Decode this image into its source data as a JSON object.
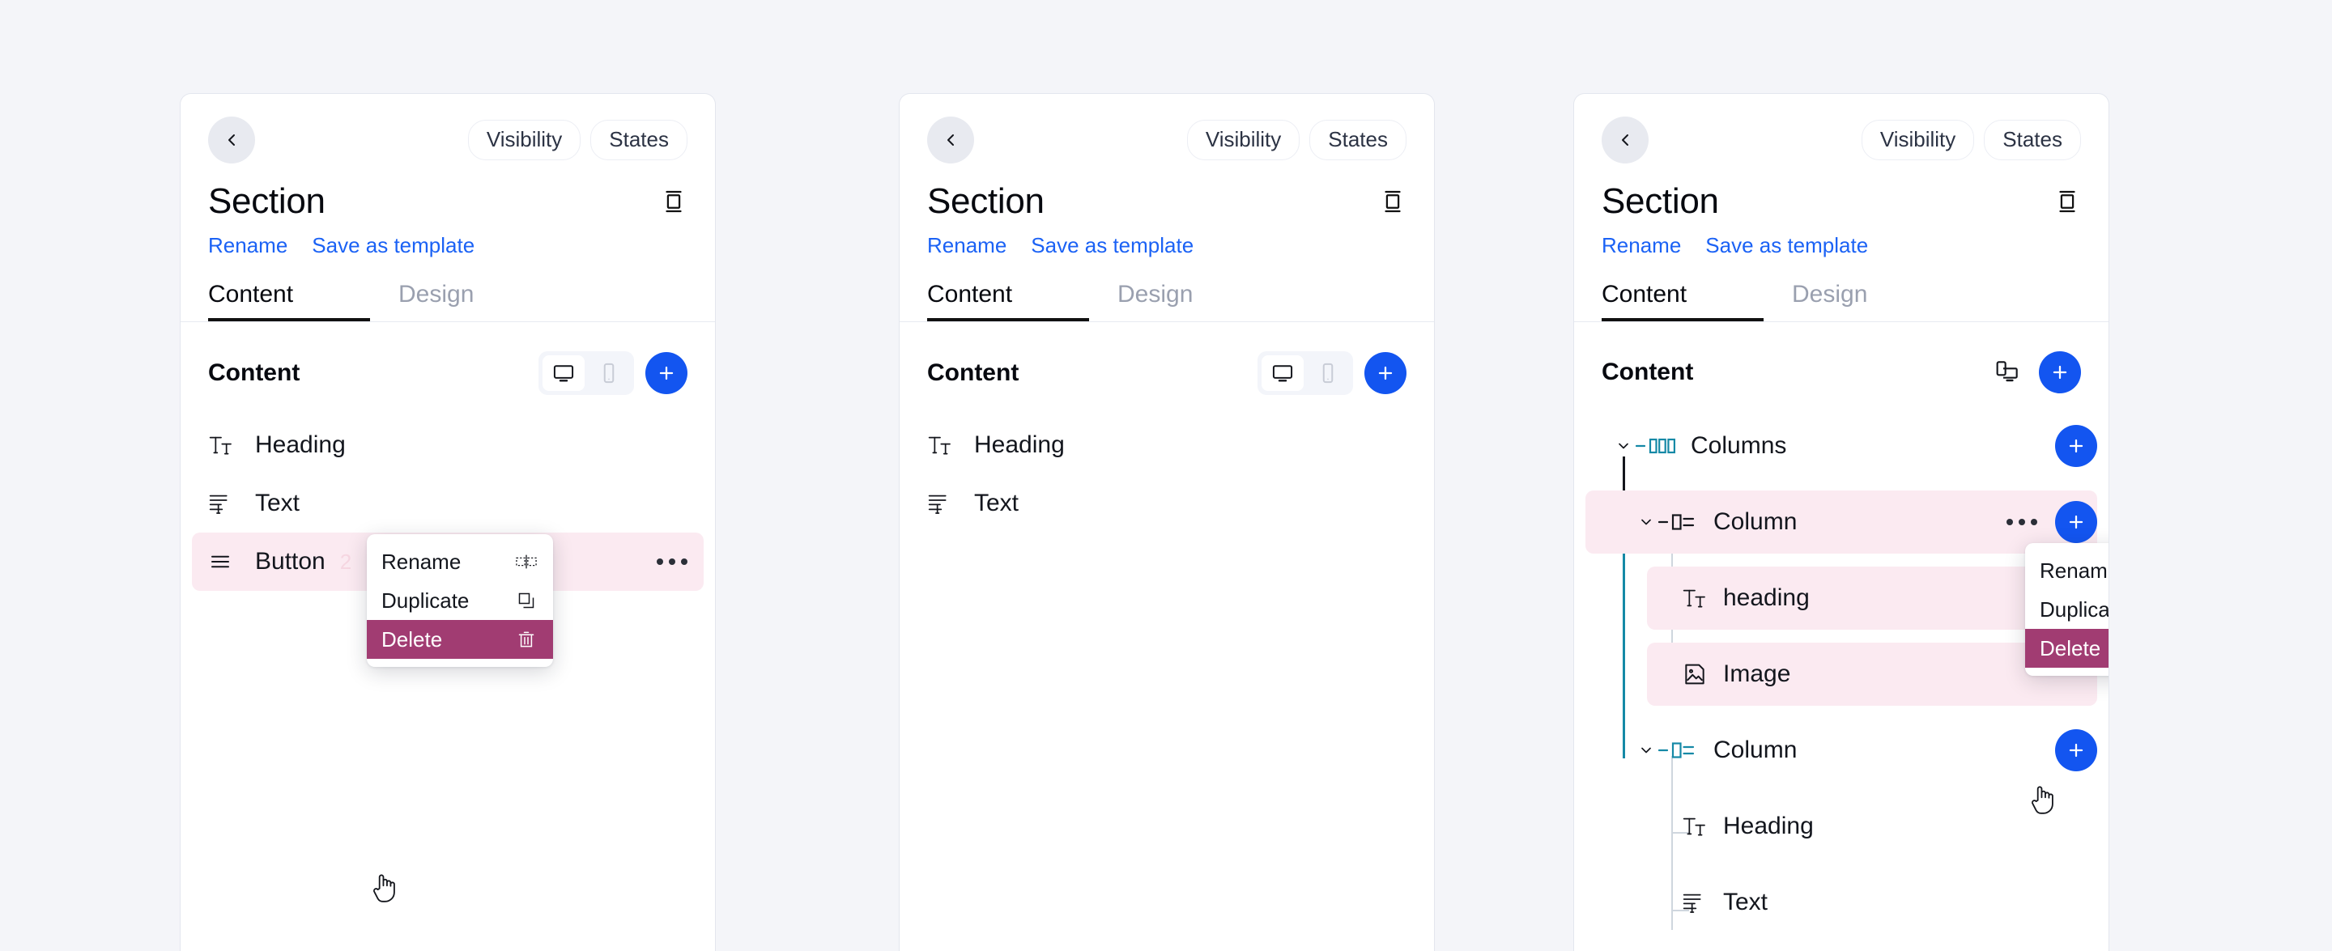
{
  "theme": {
    "page_bg": "#f4f5f9",
    "panel_bg": "#ffffff",
    "accent_blue": "#1355f0",
    "link_blue": "#1b62f5",
    "danger_magenta": "#a13c72",
    "selected_pink": "#fbeaf1",
    "teal": "#1589a6",
    "text_dark": "#13161d",
    "muted": "#9aa0af"
  },
  "panels": [
    {
      "id": "panel-1",
      "header": {
        "back_icon": "chevron-left-icon",
        "pills": [
          "Visibility",
          "States"
        ],
        "title": "Section",
        "section_icon": "section-frame-icon",
        "links": [
          "Rename",
          "Save as template"
        ],
        "tabs": [
          {
            "label": "Content",
            "active": true
          },
          {
            "label": "Design",
            "active": false
          }
        ]
      },
      "content": {
        "label": "Content",
        "toolbar_type": "segmented",
        "segments": [
          {
            "icon": "desktop-icon",
            "selected": true
          },
          {
            "icon": "mobile-icon",
            "selected": false
          }
        ],
        "add_icon": "plus-icon",
        "rows": [
          {
            "icon": "heading-icon",
            "label": "Heading",
            "badge": "",
            "selected": false,
            "dots": false
          },
          {
            "icon": "text-icon",
            "label": "Text",
            "badge": "",
            "selected": false,
            "dots": false
          },
          {
            "icon": "button-icon",
            "label": "Button",
            "badge": "2",
            "selected": true,
            "dots": true
          }
        ]
      },
      "context_menu": {
        "visible": true,
        "items": [
          {
            "label": "Rename",
            "icon": "rename-icon",
            "danger": false
          },
          {
            "label": "Duplicate",
            "icon": "duplicate-icon",
            "danger": false
          },
          {
            "label": "Delete",
            "icon": "trash-icon",
            "danger": true
          }
        ],
        "cursor": "pointer-hand-cursor"
      }
    },
    {
      "id": "panel-2",
      "header": {
        "back_icon": "chevron-left-icon",
        "pills": [
          "Visibility",
          "States"
        ],
        "title": "Section",
        "section_icon": "section-frame-icon",
        "links": [
          "Rename",
          "Save as template"
        ],
        "tabs": [
          {
            "label": "Content",
            "active": true
          },
          {
            "label": "Design",
            "active": false
          }
        ]
      },
      "content": {
        "label": "Content",
        "toolbar_type": "segmented",
        "segments": [
          {
            "icon": "desktop-icon",
            "selected": true
          },
          {
            "icon": "mobile-icon",
            "selected": false
          }
        ],
        "add_icon": "plus-icon",
        "rows": [
          {
            "icon": "heading-icon",
            "label": "Heading",
            "badge": "",
            "selected": false,
            "dots": false
          },
          {
            "icon": "text-icon",
            "label": "Text",
            "badge": "",
            "selected": false,
            "dots": false
          }
        ]
      },
      "context_menu": {
        "visible": false,
        "items": [],
        "cursor": ""
      }
    },
    {
      "id": "panel-3",
      "header": {
        "back_icon": "chevron-left-icon",
        "pills": [
          "Visibility",
          "States"
        ],
        "title": "Section",
        "section_icon": "section-frame-icon",
        "links": [
          "Rename",
          "Save as template"
        ],
        "tabs": [
          {
            "label": "Content",
            "active": true
          },
          {
            "label": "Design",
            "active": false
          }
        ]
      },
      "content": {
        "label": "Content",
        "toolbar_type": "responsive",
        "responsive_icon": "responsive-devices-icon",
        "add_icon": "plus-icon",
        "tree": [
          {
            "icon": "columns-icon",
            "label": "Columns",
            "depth": 0,
            "caret": true,
            "dash": true,
            "teal": true,
            "selected": false,
            "dots": false,
            "plus": true
          },
          {
            "icon": "column-icon",
            "label": "Column",
            "depth": 1,
            "caret": true,
            "dash": true,
            "teal": false,
            "selected": true,
            "dots": true,
            "plus": true
          },
          {
            "icon": "heading-icon",
            "label": "heading",
            "depth": 2,
            "caret": false,
            "dash": false,
            "teal": false,
            "selected": true,
            "dots": false,
            "plus": false
          },
          {
            "icon": "image-icon",
            "label": "Image",
            "depth": 2,
            "caret": false,
            "dash": false,
            "teal": false,
            "selected": true,
            "dots": false,
            "plus": false
          },
          {
            "icon": "column-icon",
            "label": "Column",
            "depth": 1,
            "caret": true,
            "dash": true,
            "teal": true,
            "selected": false,
            "dots": false,
            "plus": true
          },
          {
            "icon": "heading-icon",
            "label": "Heading",
            "depth": 2,
            "caret": false,
            "dash": false,
            "teal": false,
            "selected": false,
            "dots": false,
            "plus": false
          },
          {
            "icon": "text-icon",
            "label": "Text",
            "depth": 2,
            "caret": false,
            "dash": false,
            "teal": false,
            "selected": false,
            "dots": false,
            "plus": false
          }
        ]
      },
      "context_menu": {
        "visible": true,
        "items": [
          {
            "label": "Rename",
            "icon": "rename-icon",
            "danger": false
          },
          {
            "label": "Duplicate",
            "icon": "duplicate-icon",
            "danger": false
          },
          {
            "label": "Delete",
            "icon": "trash-icon",
            "danger": true
          }
        ],
        "cursor": "pointer-hand-cursor"
      }
    }
  ]
}
